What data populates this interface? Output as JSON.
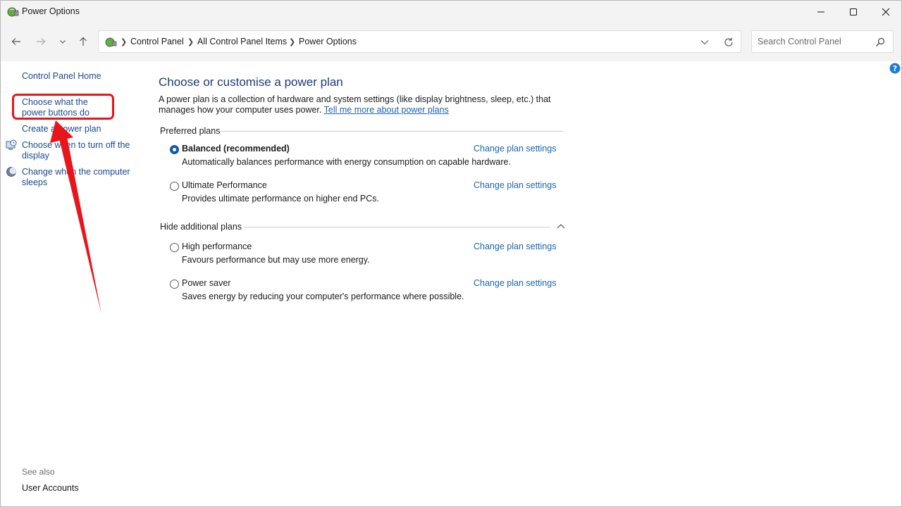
{
  "window": {
    "title": "Power Options",
    "controls": {
      "minimize": "minimize-icon",
      "maximize": "maximize-icon",
      "close": "close-icon"
    }
  },
  "nav": {
    "breadcrumbs": [
      "Control Panel",
      "All Control Panel Items",
      "Power Options"
    ],
    "search_placeholder": "Search Control Panel"
  },
  "sidebar": {
    "home": "Control Panel Home",
    "links": [
      {
        "label": "Choose what the power buttons do",
        "icon": ""
      },
      {
        "label": "Create a power plan",
        "icon": ""
      },
      {
        "label": "Choose when to turn off the display",
        "icon": "monitor-clock-icon"
      },
      {
        "label": "Change when the computer sleeps",
        "icon": "moon-icon"
      }
    ],
    "see_also": "See also",
    "user_accounts": "User Accounts"
  },
  "main": {
    "heading": "Choose or customise a power plan",
    "description": "A power plan is a collection of hardware and system settings (like display brightness, sleep, etc.) that manages how your computer uses power.",
    "description_link": "Tell me more about power plans",
    "preferred_heading": "Preferred plans",
    "hidden_heading": "Hide additional plans",
    "plans": [
      {
        "name": "Balanced (recommended)",
        "description": "Automatically balances performance with energy consumption on capable hardware.",
        "link": "Change plan settings",
        "selected": true
      },
      {
        "name": "Ultimate Performance",
        "description": "Provides ultimate performance on higher end PCs.",
        "link": "Change plan settings",
        "selected": false
      },
      {
        "name": "High performance",
        "description": "Favours performance but may use more energy.",
        "link": "Change plan settings",
        "selected": false
      },
      {
        "name": "Power saver",
        "description": "Saves energy by reducing your computer's performance where possible.",
        "link": "Change plan settings",
        "selected": false
      }
    ]
  },
  "colors": {
    "link": "#1b63b7",
    "heading": "#1e3a78",
    "selected_radio": "#0b5cad",
    "annotation": "#e8151b",
    "chrome": "#f3f3f3"
  }
}
